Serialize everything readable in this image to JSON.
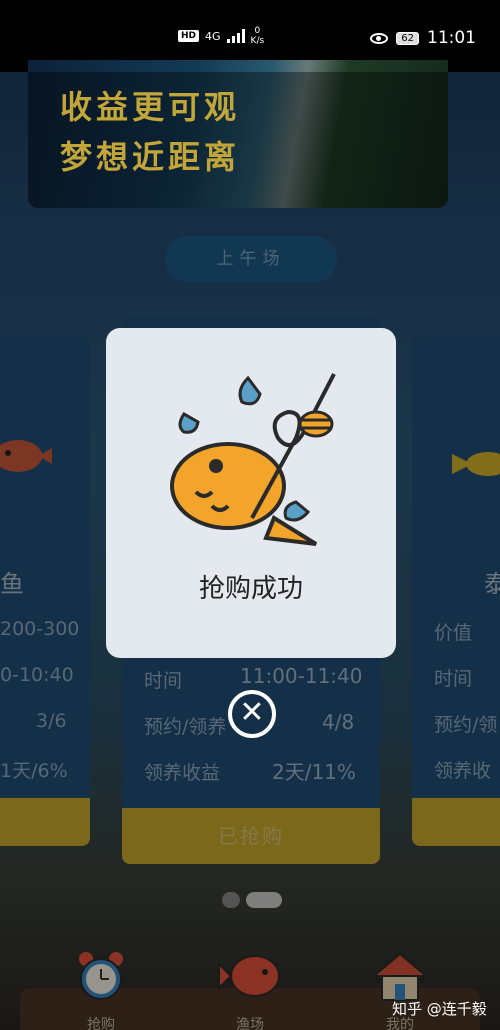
{
  "status_bar": {
    "hd": "HD",
    "network": "4G",
    "speed_value": "0",
    "speed_unit": "K/s",
    "battery": "62",
    "time": "11:01"
  },
  "banner": {
    "line1": "收益更可观",
    "line2": "梦想近距离"
  },
  "session_label": "上午场",
  "cards": {
    "left": {
      "name": "鱼",
      "price": "200-300",
      "time": "0-10:40",
      "reserve": "3/6",
      "yield": "1天/6%"
    },
    "center": {
      "time_label": "时间",
      "time_value": "11:00-11:40",
      "reserve_label": "预约/领养",
      "reserve_value": "4/8",
      "yield_label": "领养收益",
      "yield_value": "2天/11%",
      "button": "已抢购"
    },
    "right": {
      "name": "泰",
      "price_label": "价值",
      "time_label": "时间",
      "reserve_label": "预约/领",
      "yield_label": "领养收"
    }
  },
  "modal": {
    "title": "抢购成功",
    "icon": "fish-hook-icon",
    "close_icon": "close-icon"
  },
  "bottom_nav": {
    "items": [
      {
        "label": "抢购",
        "icon": "alarm-clock-icon"
      },
      {
        "label": "渔场",
        "icon": "fish-icon"
      },
      {
        "label": "我的",
        "icon": "house-icon"
      }
    ]
  },
  "watermark": "知乎 @连千毅",
  "colors": {
    "accent_gold": "#c7a92b",
    "card_blue": "#1f4e74",
    "modal_bg": "#e3e9ee",
    "fish_orange": "#f2a52a"
  }
}
